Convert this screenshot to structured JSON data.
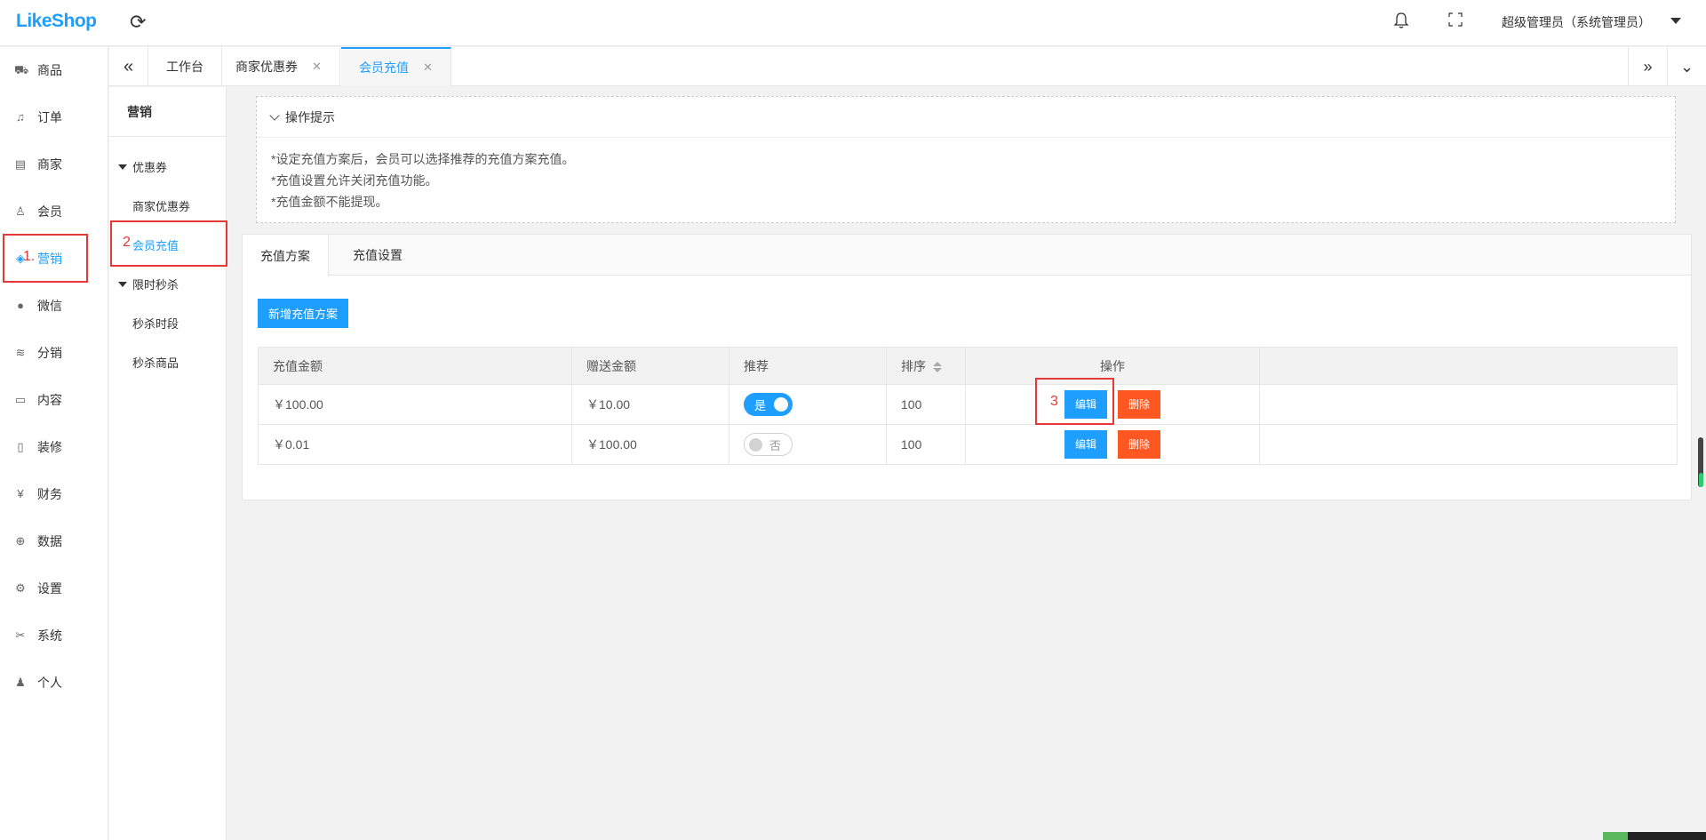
{
  "header": {
    "logo": "LikeShop",
    "user": "超级管理员（系统管理员）"
  },
  "leftnav": {
    "items": [
      {
        "label": "商品",
        "icon": "cart-icon"
      },
      {
        "label": "订单",
        "icon": "bell-icon"
      },
      {
        "label": "商家",
        "icon": "store-icon"
      },
      {
        "label": "会员",
        "icon": "user-icon"
      },
      {
        "label": "营销",
        "icon": "marketing-icon"
      },
      {
        "label": "微信",
        "icon": "wechat-icon"
      },
      {
        "label": "分销",
        "icon": "layers-icon"
      },
      {
        "label": "内容",
        "icon": "book-icon"
      },
      {
        "label": "装修",
        "icon": "mobile-icon"
      },
      {
        "label": "财务",
        "icon": "yen-icon"
      },
      {
        "label": "数据",
        "icon": "globe-icon"
      },
      {
        "label": "设置",
        "icon": "gear-icon"
      },
      {
        "label": "系统",
        "icon": "tools-icon"
      },
      {
        "label": "个人",
        "icon": "person-icon"
      }
    ],
    "active_index": 4
  },
  "tabs": [
    {
      "label": "工作台"
    },
    {
      "label": "商家优惠券"
    },
    {
      "label": "会员充值"
    }
  ],
  "subnav": {
    "title": "营销",
    "groups": [
      {
        "label": "优惠券",
        "items": [
          "商家优惠券",
          "会员充值"
        ]
      },
      {
        "label": "限时秒杀",
        "items": [
          "秒杀时段",
          "秒杀商品"
        ]
      }
    ]
  },
  "tips": {
    "title": "操作提示",
    "lines": [
      "*设定充值方案后，会员可以选择推荐的充值方案充值。",
      "*充值设置允许关闭充值功能。",
      "*充值金额不能提现。"
    ]
  },
  "card": {
    "tabs": [
      "充值方案",
      "充值设置"
    ],
    "add_button": "新增充值方案",
    "columns": [
      "充值金额",
      "赠送金额",
      "推荐",
      "排序",
      "操作"
    ],
    "rows": [
      {
        "amount": "￥100.00",
        "gift": "￥10.00",
        "recommend": "是",
        "recommend_on": true,
        "sort": "100"
      },
      {
        "amount": "￥0.01",
        "gift": "￥100.00",
        "recommend": "否",
        "recommend_on": false,
        "sort": "100"
      }
    ],
    "edit_label": "编辑",
    "delete_label": "删除"
  },
  "annotations": [
    "1.",
    "2",
    "3"
  ],
  "colors": {
    "accent": "#1e9fff",
    "danger": "#ff5722",
    "annotation": "#e53935"
  }
}
